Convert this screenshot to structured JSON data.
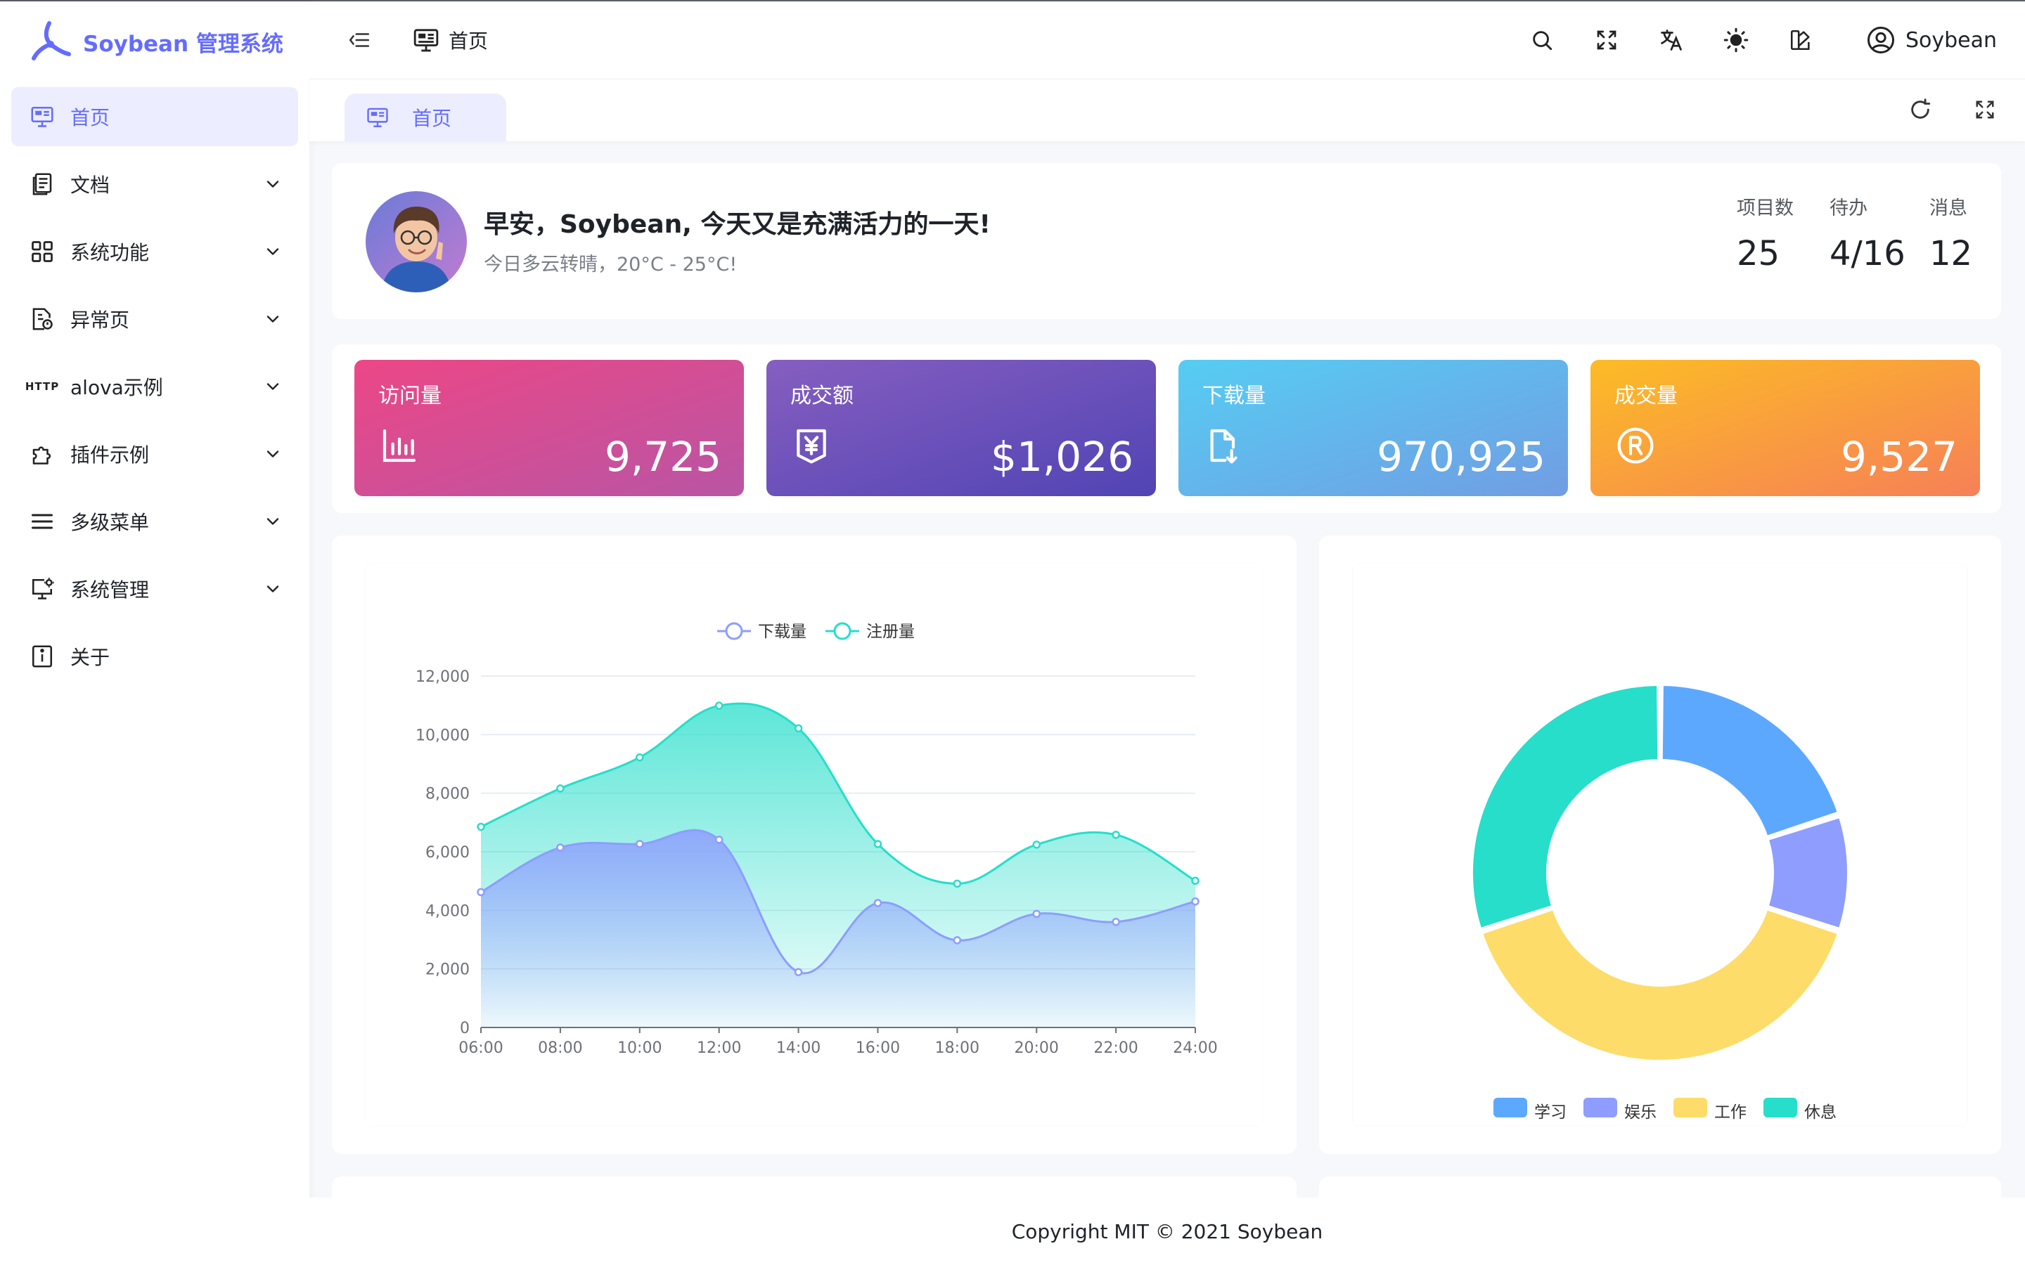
{
  "app": {
    "title": "Soybean 管理系统"
  },
  "sidebar": {
    "items": [
      {
        "label": "首页",
        "icon": "monitor-icon",
        "active": true,
        "expandable": false
      },
      {
        "label": "文档",
        "icon": "document-icon",
        "expandable": true
      },
      {
        "label": "系统功能",
        "icon": "grid-icon",
        "expandable": true
      },
      {
        "label": "异常页",
        "icon": "error-page-icon",
        "expandable": true
      },
      {
        "label": "alova示例",
        "icon": "http-icon",
        "icon_text": "HTTP",
        "expandable": true
      },
      {
        "label": "插件示例",
        "icon": "puzzle-icon",
        "expandable": true
      },
      {
        "label": "多级菜单",
        "icon": "menu-lines-icon",
        "expandable": true
      },
      {
        "label": "系统管理",
        "icon": "monitor-gear-icon",
        "expandable": true
      },
      {
        "label": "关于",
        "icon": "info-icon",
        "expandable": false
      }
    ]
  },
  "header": {
    "breadcrumb": "首页",
    "user_name": "Soybean",
    "actions": [
      "search-icon",
      "fullscreen-icon",
      "translate-icon",
      "sun-icon",
      "theme-icon"
    ]
  },
  "tabs": [
    {
      "label": "首页",
      "active": true
    }
  ],
  "welcome": {
    "greeting": "早安，Soybean, 今天又是充满活力的一天!",
    "weather": "今日多云转晴，20°C - 25°C!",
    "stats": [
      {
        "label": "项目数",
        "value": "25"
      },
      {
        "label": "待办",
        "value": "4/16"
      },
      {
        "label": "消息",
        "value": "12"
      }
    ]
  },
  "kpis": [
    {
      "title": "访问量",
      "value": "9,725",
      "icon": "bar-chart-icon",
      "colors": [
        "#ec4786",
        "#b955a4"
      ]
    },
    {
      "title": "成交额",
      "value": "$1,026",
      "icon": "money-icon",
      "colors": [
        "#865ec0",
        "#5144b4"
      ]
    },
    {
      "title": "下载量",
      "value": "970,925",
      "icon": "download-file-icon",
      "colors": [
        "#56cdf3",
        "#719de3"
      ]
    },
    {
      "title": "成交量",
      "value": "9,527",
      "icon": "registered-icon",
      "colors": [
        "#fcbc25",
        "#f68057"
      ]
    }
  ],
  "chart_data": [
    {
      "type": "area",
      "x": [
        "06:00",
        "08:00",
        "10:00",
        "12:00",
        "14:00",
        "16:00",
        "18:00",
        "20:00",
        "22:00",
        "24:00"
      ],
      "series": [
        {
          "name": "下载量",
          "values": [
            4623,
            6145,
            6268,
            6411,
            1890,
            4251,
            2978,
            3880,
            3606,
            4305
          ],
          "color": "#8e9dff"
        },
        {
          "name": "注册量",
          "values": [
            6853,
            8162,
            9223,
            10989,
            10215,
            6265,
            4912,
            6244,
            6580,
            5010
          ],
          "color": "#26deca"
        }
      ],
      "ylim": [
        0,
        12000
      ],
      "yticks": [
        "0",
        "2,000",
        "4,000",
        "6,000",
        "8,000",
        "10,000",
        "12,000"
      ],
      "grid": true,
      "legend": "top-center"
    },
    {
      "type": "pie",
      "categories": [
        "学习",
        "娱乐",
        "工作",
        "休息"
      ],
      "values": [
        20,
        10,
        40,
        30
      ],
      "colors": [
        "#5da8ff",
        "#8e9dff",
        "#fedc69",
        "#26deca"
      ],
      "donut": true,
      "legend": "bottom-center"
    }
  ],
  "footer": {
    "text": "Copyright MIT © 2021 Soybean"
  }
}
